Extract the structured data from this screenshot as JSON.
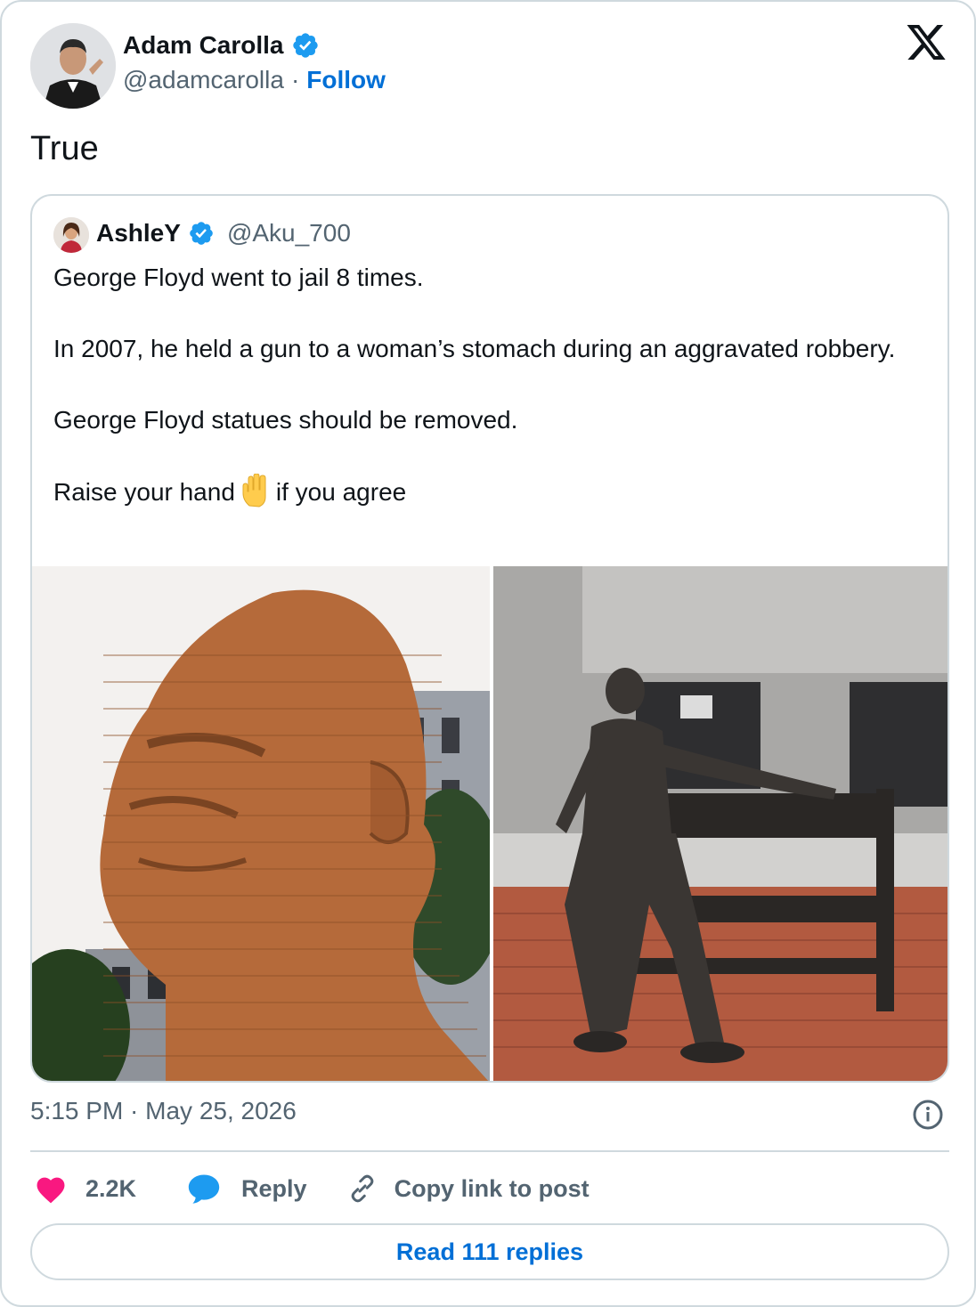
{
  "author": {
    "name": "Adam Carolla",
    "handle": "@adamcarolla",
    "separator": "·",
    "follow_label": "Follow"
  },
  "tweet": {
    "text": "True",
    "timestamp": "5:15 PM · May 25, 2026"
  },
  "quoted_tweet": {
    "name": "AshleY",
    "handle": "@Aku_700",
    "paragraphs": [
      "George Floyd went to jail 8 times.",
      "In 2007, he held a gun to a woman’s stomach during an aggravated robbery.",
      "George Floyd statues should be removed."
    ],
    "last_line_before": "Raise your hand",
    "last_line_after": "if you agree",
    "media_count": 2
  },
  "actions": {
    "like_count": "2.2K",
    "reply_label": "Reply",
    "copy_label": "Copy link to post"
  },
  "read_replies_label": "Read 111 replies",
  "icons": {
    "verified": "verified-badge-icon",
    "logo": "x-logo-icon",
    "info": "info-icon",
    "like": "heart-icon",
    "reply": "speech-bubble-icon",
    "copy": "link-icon"
  },
  "colors": {
    "link": "#006fd6",
    "verified": "#1d9bf0",
    "like": "#f91880",
    "reply": "#1d9bf0",
    "muted": "#536471",
    "border": "#cfd9de"
  }
}
